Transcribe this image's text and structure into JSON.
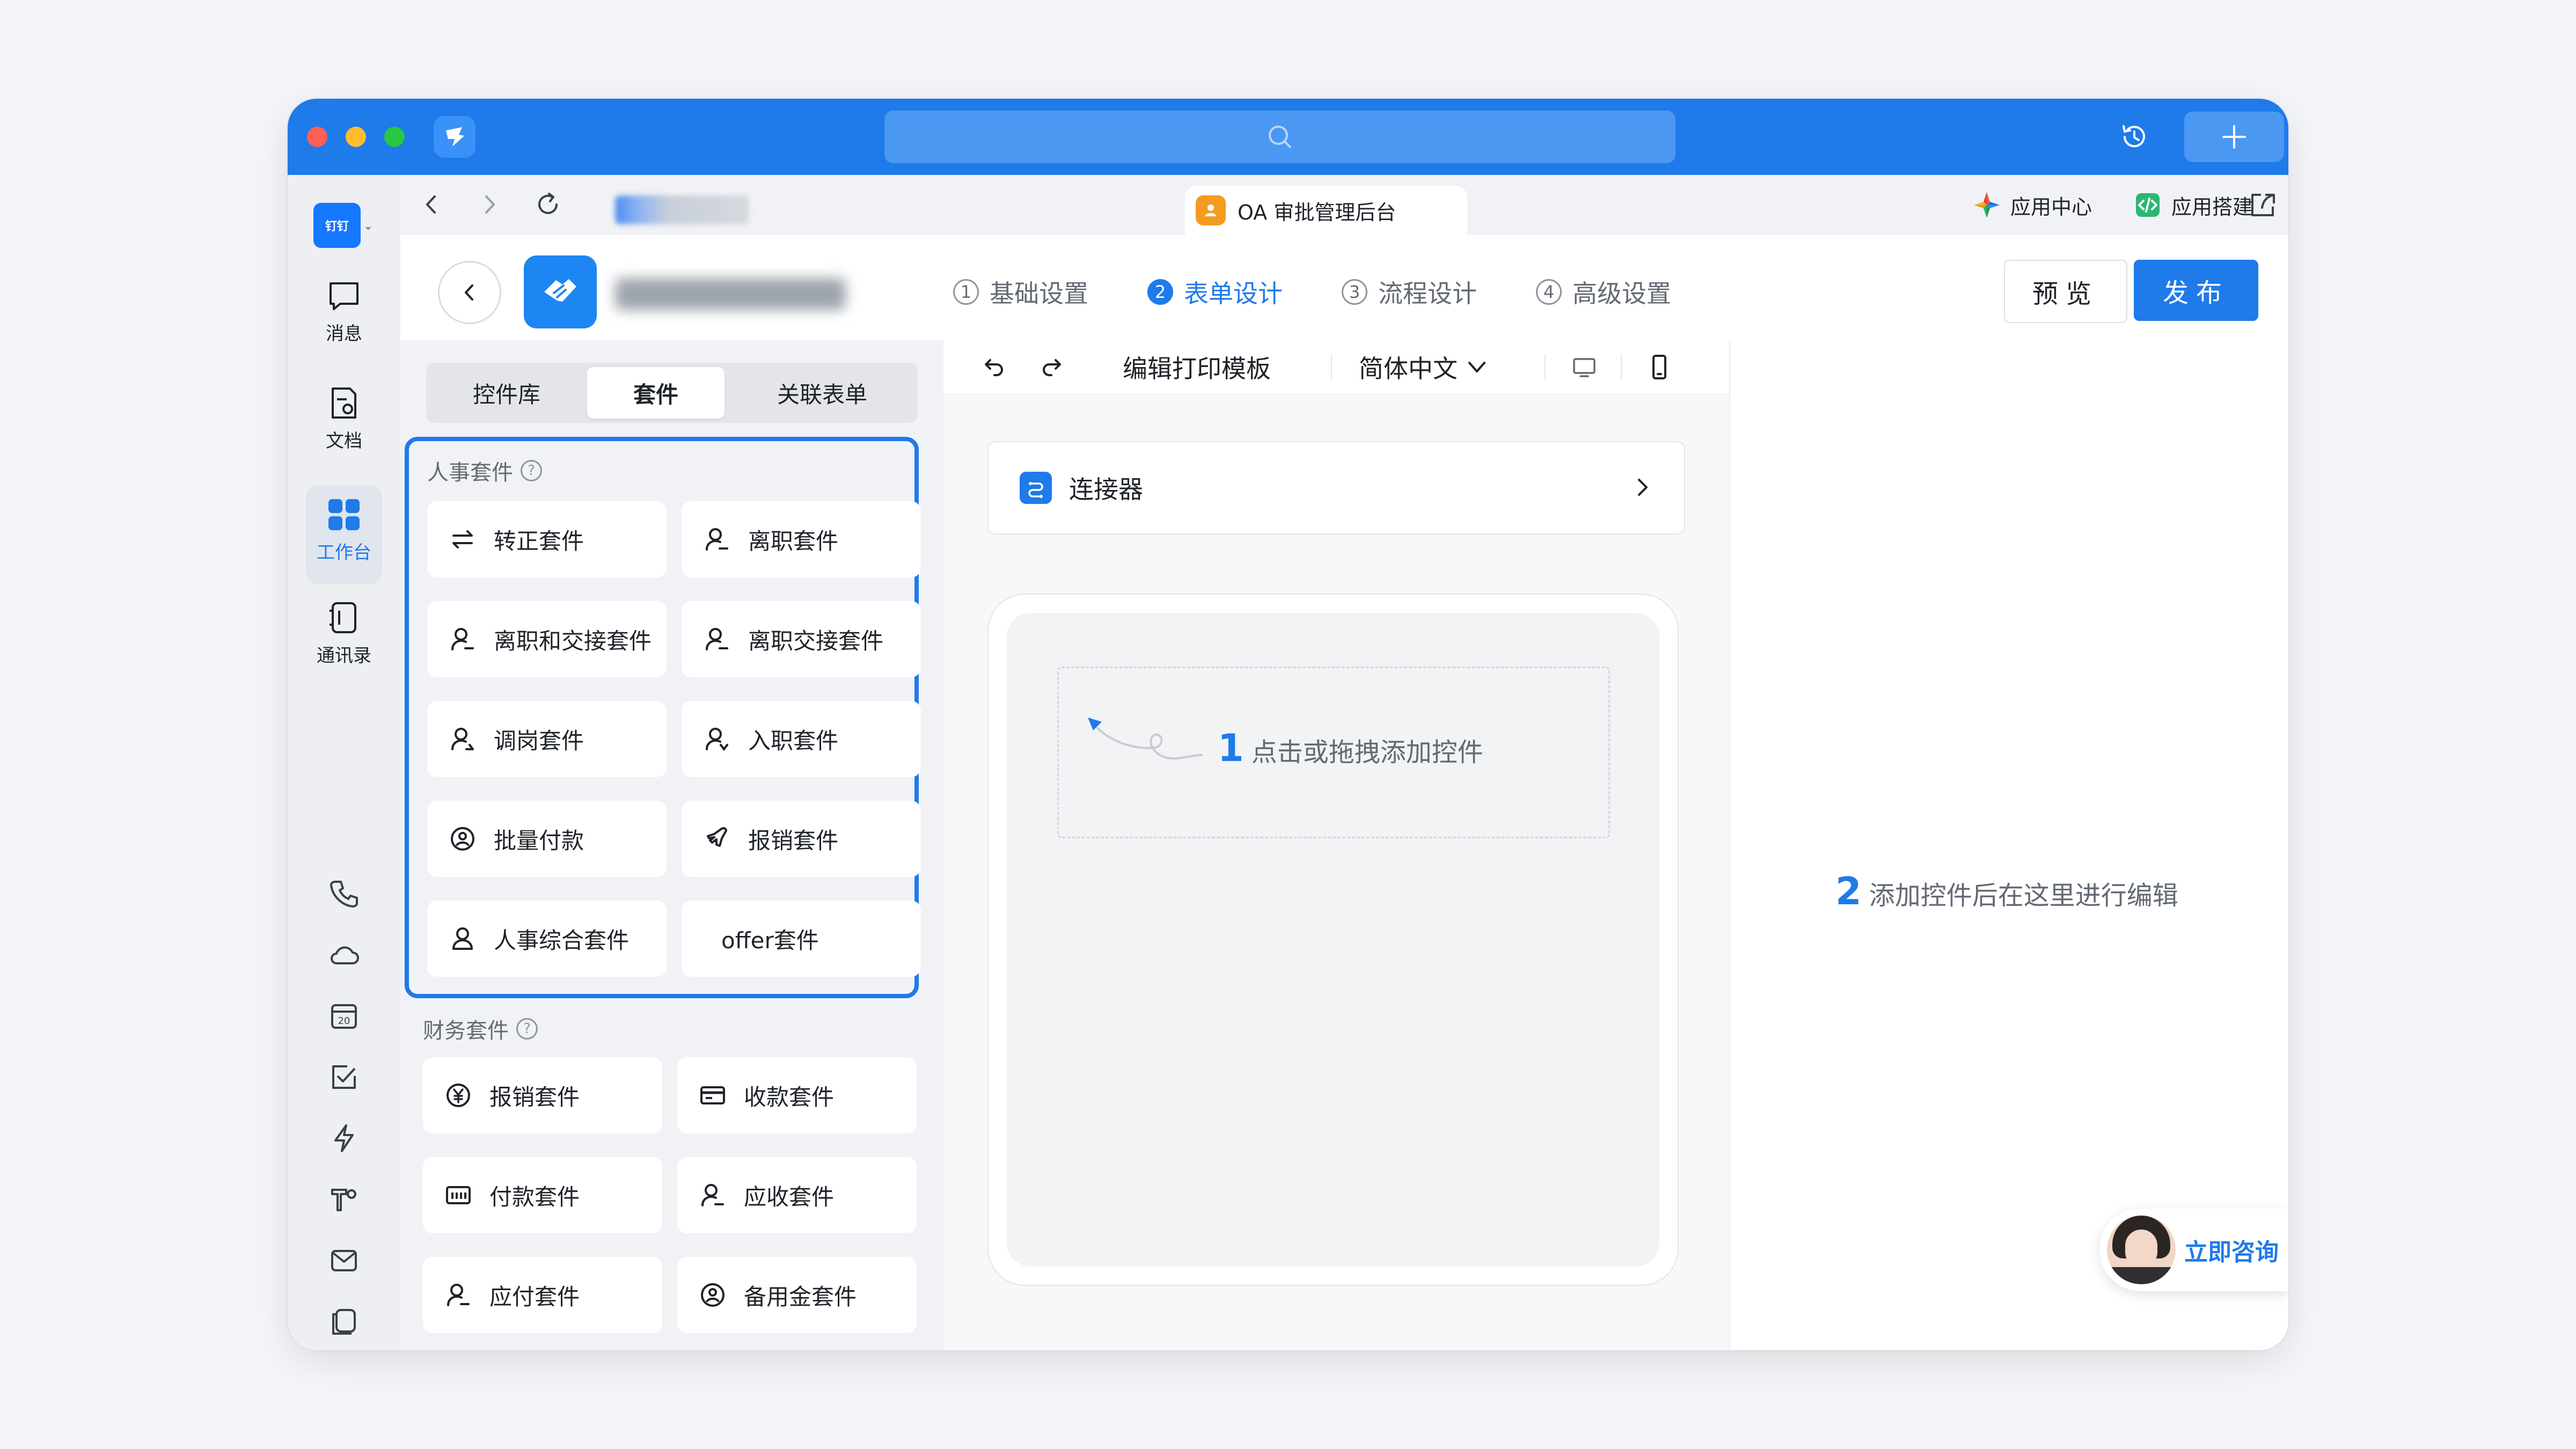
{
  "titlebar": {
    "traffic_colors": [
      "#ff5f57",
      "#febc2e",
      "#28c840"
    ],
    "search_icon": "search-icon",
    "history_icon": "history-icon",
    "plus_icon": "plus-icon"
  },
  "leftnav": {
    "avatar_label": "钉钉",
    "items": [
      {
        "label": "消息",
        "icon": "message-icon"
      },
      {
        "label": "文档",
        "icon": "document-icon"
      },
      {
        "label": "工作台",
        "icon": "workbench-icon",
        "active": true
      },
      {
        "label": "通讯录",
        "icon": "contacts-icon"
      }
    ]
  },
  "tabstrip": {
    "active_tab": "OA 审批管理后台",
    "app_center": "应用中心",
    "app_builder": "应用搭建"
  },
  "header": {
    "steps": [
      {
        "num": "1",
        "label": "基础设置"
      },
      {
        "num": "2",
        "label": "表单设计",
        "active": true
      },
      {
        "num": "3",
        "label": "流程设计"
      },
      {
        "num": "4",
        "label": "高级设置"
      }
    ],
    "preview": "预览",
    "publish": "发布",
    "accent_color": "#1f7aea"
  },
  "leftpanel": {
    "tabs": [
      "控件库",
      "套件",
      "关联表单"
    ],
    "active_tab_index": 1,
    "hr_section_title": "人事套件",
    "hr_kits": [
      {
        "label": "转正套件",
        "icon": "swap-icon"
      },
      {
        "label": "离职套件",
        "icon": "person-leave-icon"
      },
      {
        "label": "离职和交接套件",
        "icon": "person-leave-icon"
      },
      {
        "label": "离职交接套件",
        "icon": "person-leave-icon"
      },
      {
        "label": "调岗套件",
        "icon": "person-transfer-icon"
      },
      {
        "label": "入职套件",
        "icon": "person-join-icon"
      },
      {
        "label": "批量付款",
        "icon": "batch-pay-icon"
      },
      {
        "label": "报销套件",
        "icon": "plane-icon"
      },
      {
        "label": "人事综合套件",
        "icon": "person-icon"
      },
      {
        "label": "offer套件",
        "icon": ""
      }
    ],
    "finance_section_title": "财务套件",
    "finance_kits": [
      {
        "label": "报销套件",
        "icon": "yen-icon"
      },
      {
        "label": "收款套件",
        "icon": "card-icon"
      },
      {
        "label": "付款套件",
        "icon": "pay-icon"
      },
      {
        "label": "应收套件",
        "icon": "person-leave-icon"
      },
      {
        "label": "应付套件",
        "icon": "person-leave-icon"
      },
      {
        "label": "备用金套件",
        "icon": "reserve-icon"
      }
    ]
  },
  "midtoolbar": {
    "edit_print": "编辑打印模板",
    "language": "简体中文"
  },
  "canvas": {
    "connector": "连接器",
    "hint_num": "1",
    "hint_text": "点击或拖拽添加控件"
  },
  "rightpanel": {
    "hint_num": "2",
    "hint_text": "添加控件后在这里进行编辑",
    "consult": "立即咨询"
  }
}
